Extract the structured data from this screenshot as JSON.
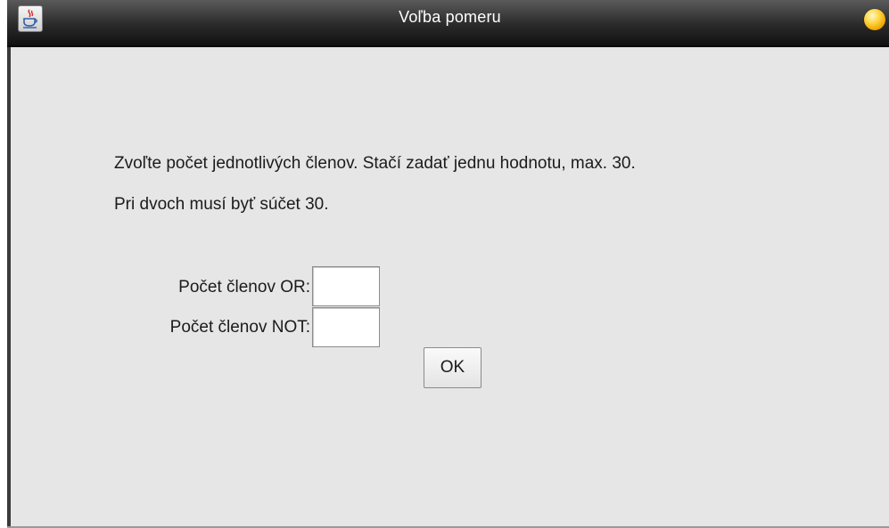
{
  "window": {
    "title": "Voľba pomeru",
    "icons": {
      "app": "java-cup-icon",
      "status": "status-orb-icon"
    }
  },
  "message": {
    "line1": "Zvoľte počet jednotlivých členov. Stačí zadať jednu hodnotu, max. 30.",
    "line2": "Pri dvoch musí byť súčet 30."
  },
  "form": {
    "or_label": "Počet členov OR:",
    "or_value": "",
    "not_label": "Počet členov NOT:",
    "not_value": "",
    "ok_label": "OK"
  },
  "colors": {
    "titlebar": "#2a2a2a",
    "background": "#e6e6e6",
    "orb": "#ffd84a"
  }
}
